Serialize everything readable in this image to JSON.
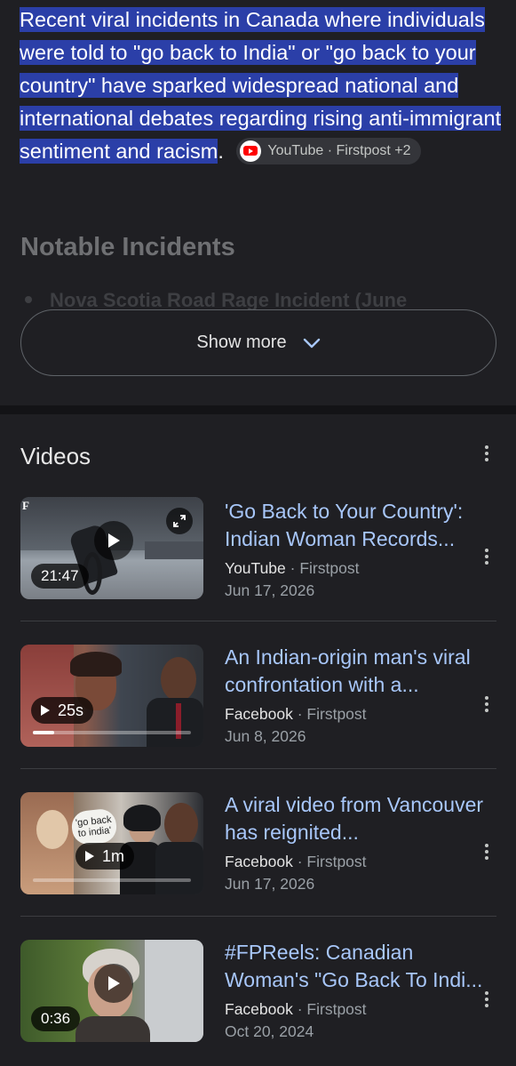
{
  "summary": {
    "text": "Recent viral incidents in Canada where individuals were told to \"go back to India\" or \"go back to your country\" have sparked widespread national and international debates regarding rising anti-immigrant sentiment and racism",
    "end_punct": ".",
    "source_chip": "YouTube · Firstpost +2",
    "source_icon": "youtube-icon"
  },
  "notable": {
    "heading": "Notable Incidents",
    "first_item": "Nova Scotia Road Rage Incident (June"
  },
  "show_more": {
    "label": "Show more"
  },
  "videos": {
    "title": "Videos",
    "items": [
      {
        "title": "'Go Back to Your Country': Indian Woman Records...",
        "source": "YouTube",
        "publisher": "Firstpost",
        "date": "Jun 17, 2026",
        "duration": "21:47",
        "thumb_logo": "F"
      },
      {
        "title": "An Indian-origin man's viral confrontation with a...",
        "source": "Facebook",
        "publisher": "Firstpost",
        "date": "Jun 8, 2026",
        "duration": "25s"
      },
      {
        "title": "A viral video from Vancouver has reignited...",
        "source": "Facebook",
        "publisher": "Firstpost",
        "date": "Jun 17, 2026",
        "duration": "1m",
        "thumb_caption": "'go back to india'"
      },
      {
        "title": "#FPReels: Canadian Woman's \"Go Back To Indi...",
        "source": "Facebook",
        "publisher": "Firstpost",
        "date": "Oct 20, 2024",
        "duration": "0:36"
      }
    ]
  },
  "colors": {
    "background": "#1f1f23",
    "highlight": "#2b3fa8",
    "link": "#a8c7fa",
    "muted": "#9aa0a6"
  }
}
